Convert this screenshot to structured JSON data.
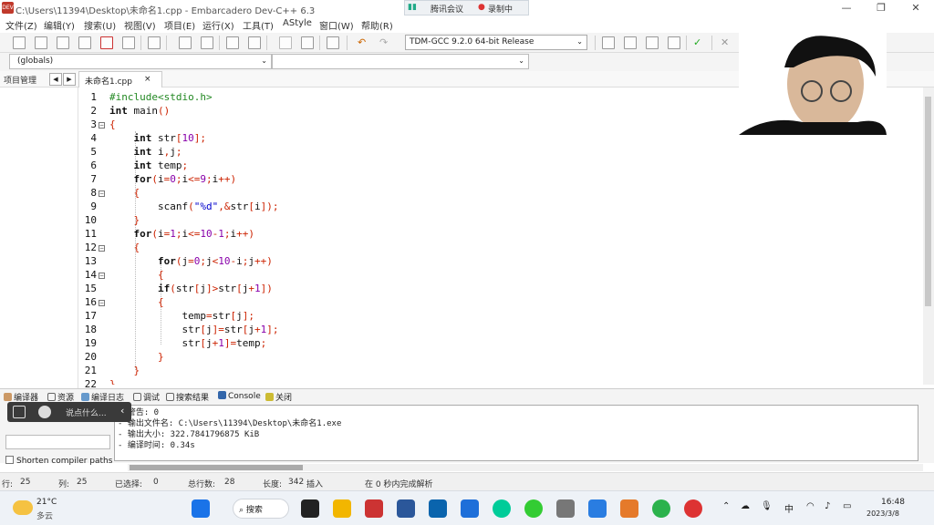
{
  "window": {
    "title": "C:\\Users\\11394\\Desktop\\未命名1.cpp - Embarcadero Dev-C++ 6.3",
    "app_icon_text": "DEV C++"
  },
  "meeting": {
    "app_label": "腾讯会议",
    "record_label": "录制中"
  },
  "menu": [
    "文件(Z)",
    "编辑(Y)",
    "搜索(U)",
    "视图(V)",
    "项目(E)",
    "运行(X)",
    "工具(T)",
    "AStyle",
    "窗口(W)",
    "帮助(R)"
  ],
  "toolbar": {
    "compiler": "TDM-GCC 9.2.0 64-bit Release"
  },
  "scope": {
    "globals": "(globals)",
    "members": ""
  },
  "tabs": {
    "project": "项目管理",
    "file": "未命名1.cpp",
    "close": "×",
    "prev": "◀",
    "next": "▶"
  },
  "code_lines": [
    {
      "n": "1",
      "fold": ""
    },
    {
      "n": "2",
      "fold": ""
    },
    {
      "n": "3",
      "fold": "−"
    },
    {
      "n": "4",
      "fold": ""
    },
    {
      "n": "5",
      "fold": ""
    },
    {
      "n": "6",
      "fold": ""
    },
    {
      "n": "7",
      "fold": ""
    },
    {
      "n": "8",
      "fold": "−"
    },
    {
      "n": "9",
      "fold": ""
    },
    {
      "n": "10",
      "fold": ""
    },
    {
      "n": "11",
      "fold": ""
    },
    {
      "n": "12",
      "fold": "−"
    },
    {
      "n": "13",
      "fold": ""
    },
    {
      "n": "14",
      "fold": "−"
    },
    {
      "n": "15",
      "fold": ""
    },
    {
      "n": "16",
      "fold": "−"
    },
    {
      "n": "17",
      "fold": ""
    },
    {
      "n": "18",
      "fold": ""
    },
    {
      "n": "19",
      "fold": ""
    },
    {
      "n": "20",
      "fold": ""
    },
    {
      "n": "21",
      "fold": ""
    },
    {
      "n": "22",
      "fold": ""
    }
  ],
  "code": [
    "#include<stdio.h>",
    "int main()",
    "{",
    "    int str[10];",
    "    int i,j;",
    "    int temp;",
    "    for(i=0;i<=9;i++)",
    "    {",
    "        scanf(\"%d\",&str[i]);",
    "    }",
    "    for(i=1;i<=10-1;i++)",
    "    {",
    "        for(j=0;j<10-i;j++)",
    "        {",
    "        if(str[j]>str[j+1])",
    "        {",
    "            temp=str[j];",
    "            str[j]=str[j+1];",
    "            str[j+1]=temp;",
    "        }",
    "    }",
    "}"
  ],
  "bottom_tabs": [
    "编译器",
    "资源",
    "编译日志",
    "调试",
    "搜索结果",
    "Console",
    "关闭"
  ],
  "output_lines": [
    "- 警告: 0",
    "- 输出文件名: C:\\Users\\11394\\Desktop\\未命名1.exe",
    "- 输出大小: 322.7841796875 KiB",
    "- 编译时间: 0.34s"
  ],
  "float_toolbar": {
    "chat_placeholder": "说点什么...",
    "collapse": "‹"
  },
  "shorten_label": "Shorten compiler paths",
  "status": {
    "row_label": "行:",
    "row": "25",
    "col_label": "列:",
    "col": "25",
    "sel_label": "已选择:",
    "sel": "0",
    "total_label": "总行数:",
    "total": "28",
    "len_label": "长度:",
    "len": "342",
    "mode": "插入",
    "message": "在 0 秒内完成解析"
  },
  "taskbar": {
    "weather_temp": "21°C",
    "weather_desc": "多云",
    "search": "搜索",
    "time": "16:48",
    "date": "2023/3/8",
    "ime": "中"
  },
  "colors": {
    "keyword": "#111111",
    "number": "#8800aa",
    "operator": "#cc2200",
    "preprocessor": "#228822",
    "string": "#0000cc"
  }
}
